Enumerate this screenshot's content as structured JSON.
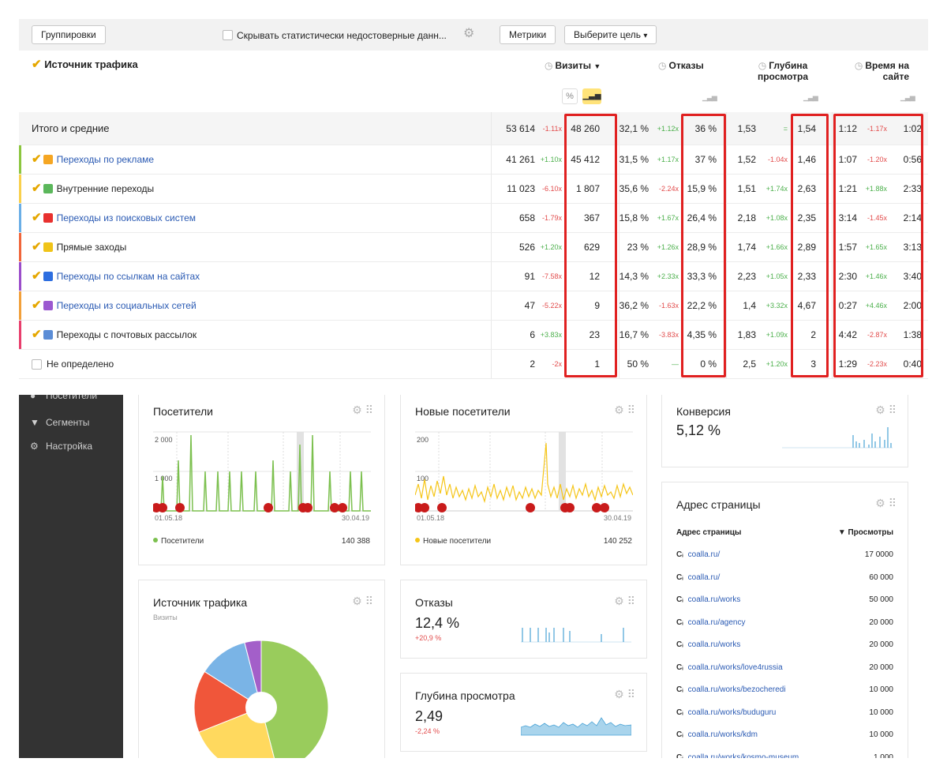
{
  "toolbar": {
    "groupings_label": "Группировки",
    "hide_unreliable_label": "Скрывать статистически недостоверные данн...",
    "metrics_label": "Метрики",
    "goal_label": "Выберите цель"
  },
  "table": {
    "dimension_header": "Источник трафика",
    "col_visits": "Визиты",
    "col_bounces": "Отказы",
    "col_depth_1": "Глубина",
    "col_depth_2": "просмотра",
    "col_time_1": "Время на",
    "col_time_2": "сайте",
    "percent_toggle": "%",
    "total": {
      "name": "Итого и средние",
      "visits_a": "53 614",
      "visits_d": "-1.11x",
      "visits_b": "48 260",
      "bounce_a": "32,1 %",
      "bounce_d": "+1.12x",
      "bounce_b": "36 %",
      "depth_a": "1,53",
      "depth_d": "=",
      "depth_b": "1,54",
      "time_a": "1:12",
      "time_d": "-1.17x",
      "time_b": "1:02"
    },
    "rows": [
      {
        "name": "Переходы по рекламе",
        "link": true,
        "color": "#8cc63f",
        "icon_color": "#f5a623",
        "visits_a": "41 261",
        "visits_d": "+1.10x",
        "visits_b": "45 412",
        "bounce_a": "31,5 %",
        "bounce_d": "+1.17x",
        "bounce_b": "37 %",
        "depth_a": "1,52",
        "depth_d": "-1.04x",
        "depth_b": "1,46",
        "time_a": "1:07",
        "time_d": "-1.20x",
        "time_b": "0:56"
      },
      {
        "name": "Внутренние переходы",
        "link": false,
        "color": "#f9d04c",
        "icon_color": "#5bb75b",
        "visits_a": "11 023",
        "visits_d": "-6.10x",
        "visits_b": "1 807",
        "bounce_a": "35,6 %",
        "bounce_d": "-2.24x",
        "bounce_b": "15,9 %",
        "depth_a": "1,51",
        "depth_d": "+1.74x",
        "depth_b": "2,63",
        "time_a": "1:21",
        "time_d": "+1.88x",
        "time_b": "2:33"
      },
      {
        "name": "Переходы из поисковых систем",
        "link": true,
        "color": "#6aaee6",
        "icon_color": "#e8312f",
        "visits_a": "658",
        "visits_d": "-1.79x",
        "visits_b": "367",
        "bounce_a": "15,8 %",
        "bounce_d": "+1.67x",
        "bounce_b": "26,4 %",
        "depth_a": "2,18",
        "depth_d": "+1.08x",
        "depth_b": "2,35",
        "time_a": "3:14",
        "time_d": "-1.45x",
        "time_b": "2:14"
      },
      {
        "name": "Прямые заходы",
        "link": false,
        "color": "#f0653a",
        "icon_color": "#f0c419",
        "visits_a": "526",
        "visits_d": "+1.20x",
        "visits_b": "629",
        "bounce_a": "23 %",
        "bounce_d": "+1.26x",
        "bounce_b": "28,9 %",
        "depth_a": "1,74",
        "depth_d": "+1.66x",
        "depth_b": "2,89",
        "time_a": "1:57",
        "time_d": "+1.65x",
        "time_b": "3:13"
      },
      {
        "name": "Переходы по ссылкам на сайтах",
        "link": true,
        "color": "#9b4dca",
        "icon_color": "#2d6ee0",
        "visits_a": "91",
        "visits_d": "-7.58x",
        "visits_b": "12",
        "bounce_a": "14,3 %",
        "bounce_d": "+2.33x",
        "bounce_b": "33,3 %",
        "depth_a": "2,23",
        "depth_d": "+1.05x",
        "depth_b": "2,33",
        "time_a": "2:30",
        "time_d": "+1.46x",
        "time_b": "3:40"
      },
      {
        "name": "Переходы из социальных сетей",
        "link": true,
        "color": "#f2a03a",
        "icon_color": "#9b59d0",
        "visits_a": "47",
        "visits_d": "-5.22x",
        "visits_b": "9",
        "bounce_a": "36,2 %",
        "bounce_d": "-1.63x",
        "bounce_b": "22,2 %",
        "depth_a": "1,4",
        "depth_d": "+3.32x",
        "depth_b": "4,67",
        "time_a": "0:27",
        "time_d": "+4.46x",
        "time_b": "2:00"
      },
      {
        "name": "Переходы с почтовых рассылок",
        "link": false,
        "color": "#e83e6c",
        "icon_color": "#5b8dd6",
        "visits_a": "6",
        "visits_d": "+3.83x",
        "visits_b": "23",
        "bounce_a": "16,7 %",
        "bounce_d": "-3.83x",
        "bounce_b": "4,35 %",
        "depth_a": "1,83",
        "depth_d": "+1.09x",
        "depth_b": "2",
        "time_a": "4:42",
        "time_d": "-2.87x",
        "time_b": "1:38"
      },
      {
        "name": "Не определено",
        "link": false,
        "color": "",
        "icon_color": "",
        "visits_a": "2",
        "visits_d": "-2x",
        "visits_b": "1",
        "bounce_a": "50 %",
        "bounce_d": "—",
        "bounce_b": "0 %",
        "depth_a": "2,5",
        "depth_d": "+1.20x",
        "depth_b": "3",
        "time_a": "1:29",
        "time_d": "-2.23x",
        "time_b": "0:40"
      }
    ]
  },
  "sidebar": {
    "items": [
      {
        "label": "Посетители"
      },
      {
        "label": "Сегменты"
      },
      {
        "label": "Настройка"
      }
    ]
  },
  "widgets": {
    "visitors": {
      "title": "Посетители",
      "y_top": "2 000",
      "y_mid": "1 000",
      "date_start": "01.05.18",
      "date_end": "30.04.19",
      "legend": "Посетители",
      "total": "140 388",
      "color": "#7cc04f"
    },
    "new_visitors": {
      "title": "Новые посетители",
      "y_top": "200",
      "y_mid": "100",
      "date_start": "01.05.18",
      "date_end": "30.04.19",
      "legend": "Новые посетители",
      "total": "140 252",
      "color": "#f5c518"
    },
    "conversion": {
      "title": "Конверсия",
      "value": "5,12 %"
    },
    "traffic_source": {
      "title": "Источник трафика",
      "subtitle": "Визиты"
    },
    "bounces": {
      "title": "Отказы",
      "value": "12,4 %",
      "delta": "+20,9 %"
    },
    "depth": {
      "title": "Глубина просмотра",
      "value": "2,49",
      "delta": "-2,24 %"
    },
    "pages": {
      "title": "Адрес страницы",
      "col_url": "Адрес страницы",
      "col_views": "▼ Просмотры",
      "rows": [
        {
          "url": "coalla.ru/",
          "views": "17 0000"
        },
        {
          "url": "coalla.ru/",
          "views": "60 000"
        },
        {
          "url": "coalla.ru/works",
          "views": "50 000"
        },
        {
          "url": "coalla.ru/agency",
          "views": "20 000"
        },
        {
          "url": "coalla.ru/works",
          "views": "20 000"
        },
        {
          "url": "coalla.ru/works/love4russia",
          "views": "20 000"
        },
        {
          "url": "coalla.ru/works/bezocheredi",
          "views": "10 000"
        },
        {
          "url": "coalla.ru/works/buduguru",
          "views": "10 000"
        },
        {
          "url": "coalla.ru/works/kdm",
          "views": "10 000"
        },
        {
          "url": "coalla.ru/works/kosmo-museum",
          "views": "1 000"
        }
      ]
    }
  },
  "chart_data": [
    {
      "type": "pie",
      "title": "Источник трафика",
      "subtitle": "Визиты",
      "slices": [
        {
          "value": 46,
          "color": "#99cc5c"
        },
        {
          "value": 23,
          "color": "#ffd95e"
        },
        {
          "value": 15,
          "color": "#f0563a"
        },
        {
          "value": 12,
          "color": "#7ab4e6"
        },
        {
          "value": 4,
          "color": "#a35fc9"
        }
      ]
    }
  ]
}
